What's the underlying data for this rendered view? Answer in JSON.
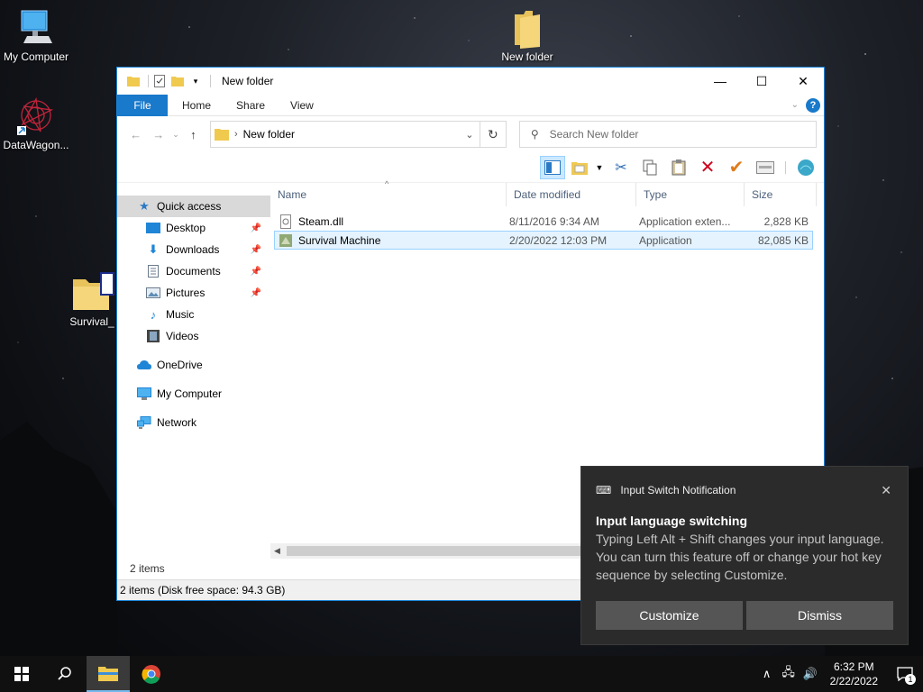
{
  "desktop": {
    "icons": [
      {
        "label": "My Computer"
      },
      {
        "label": "DataWagon..."
      },
      {
        "label": "Survival_"
      },
      {
        "label": "New folder"
      }
    ]
  },
  "window": {
    "title": "New folder",
    "controls": {
      "minimize": "—",
      "maximize": "☐",
      "close": "✕"
    },
    "ribbon": {
      "tabs": [
        "File",
        "Home",
        "Share",
        "View"
      ],
      "help": "?"
    },
    "address": {
      "path": "New folder",
      "search_placeholder": "Search New folder"
    },
    "nav": {
      "quick_access": "Quick access",
      "pinned": [
        {
          "label": "Desktop",
          "pinned": true
        },
        {
          "label": "Downloads",
          "pinned": true
        },
        {
          "label": "Documents",
          "pinned": true
        },
        {
          "label": "Pictures",
          "pinned": true
        },
        {
          "label": "Music",
          "pinned": false
        },
        {
          "label": "Videos",
          "pinned": false
        }
      ],
      "onedrive": "OneDrive",
      "my_computer": "My Computer",
      "network": "Network"
    },
    "columns": [
      "Name",
      "Date modified",
      "Type",
      "Size"
    ],
    "files": [
      {
        "name": "Steam.dll",
        "date": "8/11/2016 9:34 AM",
        "type": "Application exten...",
        "size": "2,828 KB"
      },
      {
        "name": "Survival Machine",
        "date": "2/20/2022 12:03 PM",
        "type": "Application",
        "size": "82,085 KB"
      }
    ],
    "status_count": "2 items",
    "status_bar": "2 items (Disk free space: 94.3 GB)"
  },
  "notification": {
    "header": "Input Switch Notification",
    "title": "Input language switching",
    "body": "Typing Left Alt + Shift changes your input language. You can turn this feature off or change your hot key sequence by selecting Customize.",
    "customize": "Customize",
    "dismiss": "Dismiss"
  },
  "taskbar": {
    "time": "6:32 PM",
    "date": "2/22/2022",
    "notification_count": "1"
  },
  "colors": {
    "accent": "#1979ca",
    "selection": "#cce8ff",
    "toast_bg": "#2b2b2b",
    "taskbar_bg": "#101010"
  }
}
